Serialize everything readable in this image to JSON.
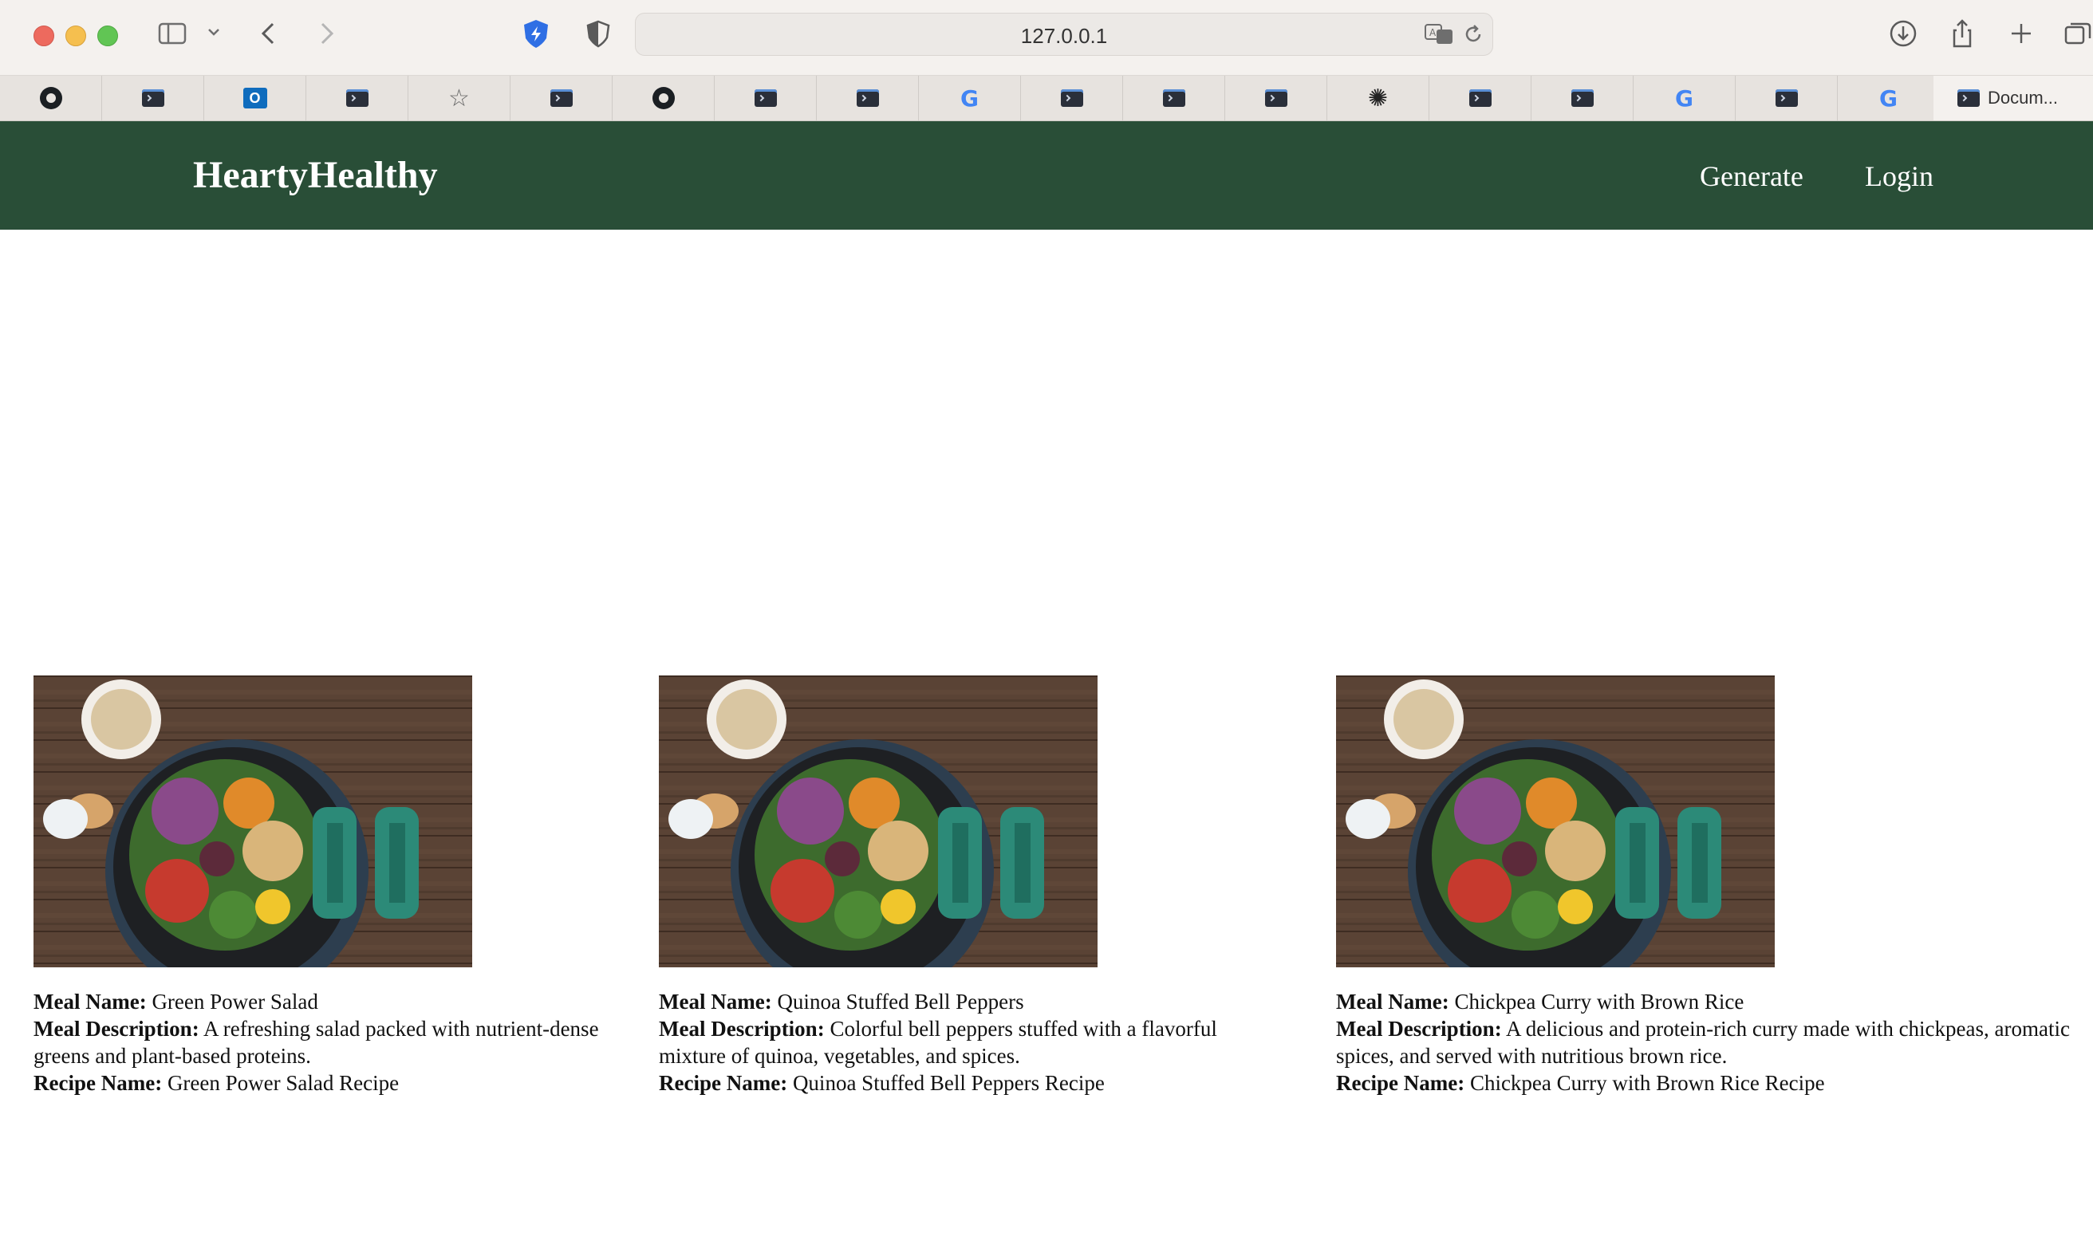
{
  "browser": {
    "url": "127.0.0.1",
    "tabs": [
      {
        "icon": "github-icon"
      },
      {
        "icon": "terminal-icon"
      },
      {
        "icon": "outlook-icon",
        "glyph": "O"
      },
      {
        "icon": "terminal-icon"
      },
      {
        "icon": "star-icon",
        "glyph": "☆"
      },
      {
        "icon": "terminal-icon"
      },
      {
        "icon": "github-icon"
      },
      {
        "icon": "terminal-icon"
      },
      {
        "icon": "terminal-icon"
      },
      {
        "icon": "google-icon",
        "glyph": "G"
      },
      {
        "icon": "terminal-icon"
      },
      {
        "icon": "terminal-icon"
      },
      {
        "icon": "terminal-icon"
      },
      {
        "icon": "chatgpt-icon",
        "glyph": "✺"
      },
      {
        "icon": "terminal-icon"
      },
      {
        "icon": "terminal-icon"
      },
      {
        "icon": "google-icon",
        "glyph": "G"
      },
      {
        "icon": "terminal-icon"
      },
      {
        "icon": "google-icon",
        "glyph": "G"
      }
    ],
    "active_tab": {
      "icon": "terminal-icon",
      "label": "Docum..."
    }
  },
  "site": {
    "brand": "HeartyHealthy",
    "nav": {
      "generate": "Generate",
      "login": "Login"
    },
    "colors": {
      "nav_bg": "#294e37",
      "nav_text": "#ffffff"
    }
  },
  "meals": [
    {
      "name_label": "Meal Name:",
      "name": "Green Power Salad",
      "desc_label": "Meal Description:",
      "desc_line1": "A refreshing salad packed with nutrient-dense",
      "desc_line2": "greens and plant-based proteins.",
      "recipe_label": "Recipe Name:",
      "recipe": "Green Power Salad Recipe"
    },
    {
      "name_label": "Meal Name:",
      "name": "Quinoa Stuffed Bell Peppers",
      "desc_label": "Meal Description:",
      "desc_line1": "Colorful bell peppers stuffed with a flavorful",
      "desc_line2": "mixture of quinoa, vegetables, and spices.",
      "recipe_label": "Recipe Name:",
      "recipe": "Quinoa Stuffed Bell Peppers Recipe"
    },
    {
      "name_label": "Meal Name:",
      "name": "Chickpea Curry with Brown Rice",
      "desc_label": "Meal Description:",
      "desc_line1": "A delicious and protein-rich curry made with chickpeas, aromatic",
      "desc_line2": "spices, and served with nutritious brown rice.",
      "recipe_label": "Recipe Name:",
      "recipe": "Chickpea Curry with Brown Rice Recipe"
    }
  ]
}
